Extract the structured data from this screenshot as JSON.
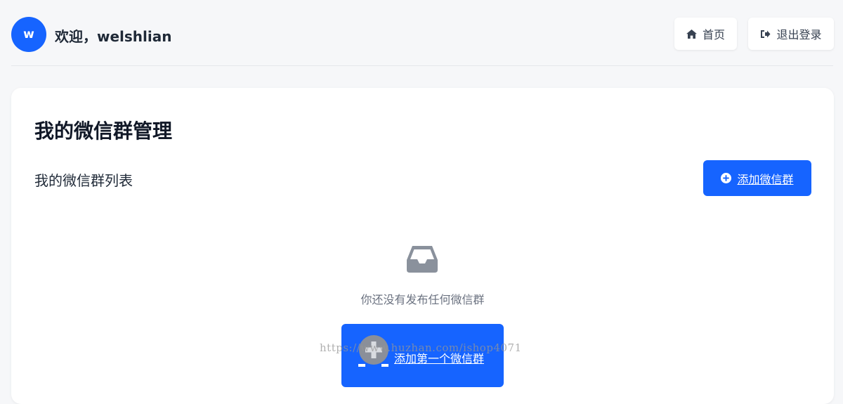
{
  "header": {
    "avatar_letter": "w",
    "welcome_text": "欢迎，welshlian",
    "home_label": "首页",
    "logout_label": "退出登录",
    "home_icon": "home-icon",
    "logout_icon": "sign-out-icon"
  },
  "main": {
    "title": "我的微信群管理",
    "list_title": "我的微信群列表",
    "add_button_label": "添加微信群",
    "add_button_icon": "plus-circle-icon",
    "empty_icon": "inbox-icon",
    "empty_text": "你还没有发布任何微信群",
    "first_button_label": "添加第一个微信群"
  },
  "watermark": "https://www.huzhan.com/ishop4071",
  "colors": {
    "primary": "#1664ff",
    "background": "#f6f7f9",
    "card": "#ffffff",
    "muted_text": "#6b7280",
    "icon_gray": "#8a919c"
  }
}
